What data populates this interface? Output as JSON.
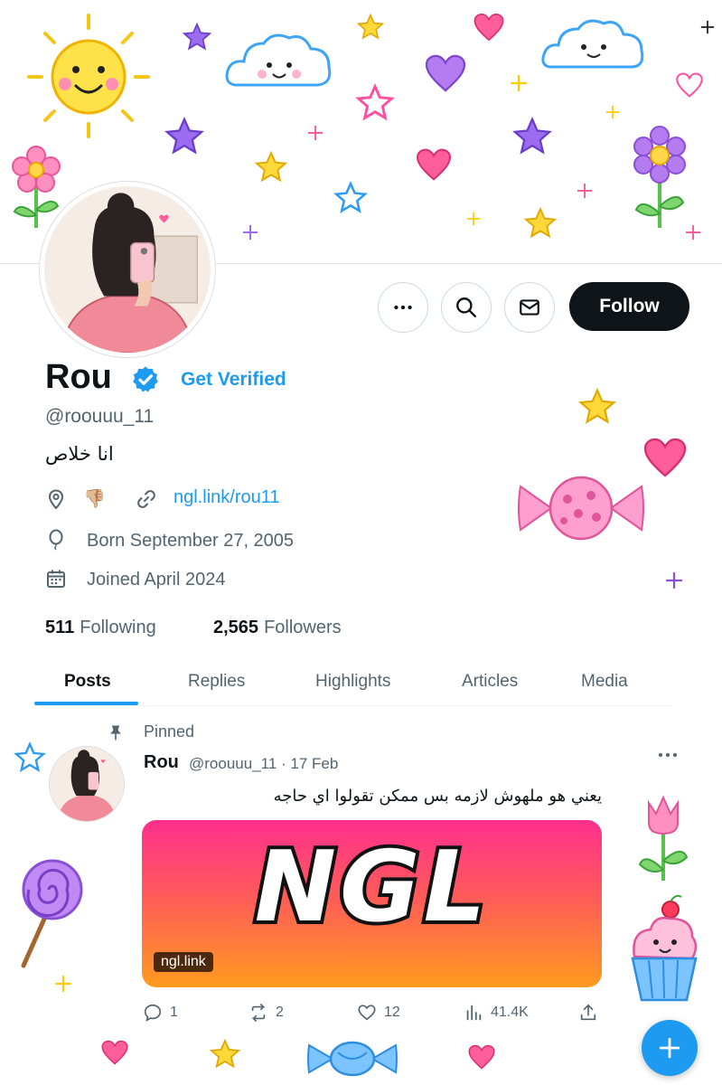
{
  "profile": {
    "name": "Rou",
    "get_verified": "Get Verified",
    "handle": "@roouuu_11",
    "bio": "انا خلاص",
    "location_emoji": "👎🏼",
    "link": "ngl.link/rou11",
    "born": "Born September 27, 2005",
    "joined": "Joined April 2024",
    "following_count": "511",
    "following_label": "Following",
    "followers_count": "2,565",
    "followers_label": "Followers"
  },
  "actions": {
    "follow_label": "Follow"
  },
  "tabs": [
    {
      "label": "Posts",
      "active": true
    },
    {
      "label": "Replies"
    },
    {
      "label": "Highlights"
    },
    {
      "label": "Articles"
    },
    {
      "label": "Media"
    }
  ],
  "post": {
    "pinned_label": "Pinned",
    "author": "Rou",
    "meta": "@roouuu_11 · 17 Feb",
    "text": "يعني هو ملهوش لازمه بس ممكن تقولوا اي حاجه",
    "card_title": "NGL",
    "card_domain": "ngl.link",
    "replies": "1",
    "reposts": "2",
    "likes": "12",
    "views": "41.4K"
  },
  "colors": {
    "accent": "#1d9bf0",
    "dark": "#0f1419",
    "muted": "#536471"
  }
}
